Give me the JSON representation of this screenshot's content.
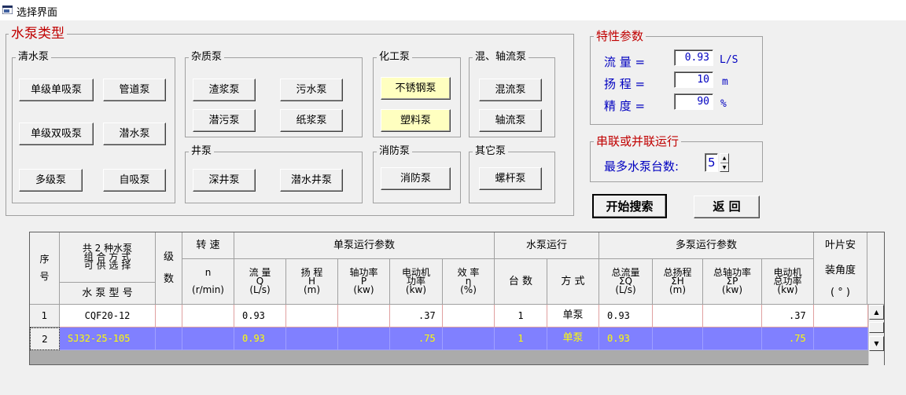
{
  "window": {
    "title": "选择界面",
    "icon": "app-icon"
  },
  "pump_types": {
    "legend": "水泵类型",
    "clear_water": {
      "legend": "清水泵",
      "buttons": [
        "单级单吸泵",
        "管道泵",
        "单级双吸泵",
        "潜水泵",
        "多级泵",
        "自吸泵"
      ]
    },
    "impurity": {
      "legend": "杂质泵",
      "buttons": [
        "渣浆泵",
        "污水泵",
        "潜污泵",
        "纸浆泵"
      ]
    },
    "well": {
      "legend": "井泵",
      "buttons": [
        "深井泵",
        "潜水井泵"
      ]
    },
    "chemical": {
      "legend": "化工泵",
      "buttons": [
        "不锈钢泵",
        "塑料泵"
      ]
    },
    "mixed_axial": {
      "legend": "混、轴流泵",
      "buttons": [
        "混流泵",
        "轴流泵"
      ]
    },
    "fire": {
      "legend": "消防泵",
      "buttons": [
        "消防泵"
      ]
    },
    "other": {
      "legend": "其它泵",
      "buttons": [
        "螺杆泵"
      ]
    }
  },
  "params": {
    "legend": "特性参数",
    "flow": {
      "label": "流  量 =",
      "value": "0.93",
      "unit": "L/S"
    },
    "head": {
      "label": "扬  程 =",
      "value": "10",
      "unit": "m"
    },
    "precision": {
      "label": "精  度 =",
      "value": "90",
      "unit": "%"
    }
  },
  "series_parallel": {
    "legend": "串联或并联运行",
    "max_label": "最多水泵台数:",
    "max_value": "5"
  },
  "actions": {
    "search": "开始搜索",
    "back": "返  回"
  },
  "table": {
    "headers": {
      "seq": "序\n\n号",
      "combo": "共 2 种水泵\n组 合 方 式\n可 供 选 择",
      "model": "水 泵 型 号",
      "stage": "级\n\n数",
      "speed_top": "转  速",
      "speed_sub": "n\n\n(r/min)",
      "single": "单泵运行参数",
      "flow": "流  量\nQ\n(L/s)",
      "head": "扬  程\nH\n(m)",
      "shaft": "轴功率\nP\n(kw)",
      "motor": "电动机\n功率\n(kw)",
      "eff": "效  率\nη\n(%)",
      "run": "水泵运行",
      "count": "台  数",
      "mode": "方  式",
      "multi": "多泵运行参数",
      "tflow": "总流量\nΣQ\n(L/s)",
      "thead": "总扬程\nΣH\n(m)",
      "tshaft": "总轴功率\nΣP\n(kw)",
      "tmotor": "电动机\n总功率\n(kw)",
      "blade1": "叶片安",
      "blade2": "装角度\n\n( ° )"
    },
    "rows": [
      {
        "num": "1",
        "model": "CQF20-12",
        "stage": "",
        "speed": "",
        "flow": "0.93",
        "head": "",
        "shaft": "",
        "motor": ".37",
        "eff": "",
        "count": "1",
        "mode": "单泵",
        "tflow": "0.93",
        "thead": "",
        "tshaft": "",
        "tmotor": ".37",
        "blade": ""
      },
      {
        "num": "2",
        "model": "SJ32-25-105",
        "stage": "",
        "speed": "",
        "flow": "0.93",
        "head": "",
        "shaft": "",
        "motor": ".75",
        "eff": "",
        "count": "1",
        "mode": "单泵",
        "tflow": "0.93",
        "thead": "",
        "tshaft": "",
        "tmotor": ".75",
        "blade": ""
      }
    ]
  },
  "colors": {
    "legend_red": "#c00000",
    "label_blue": "#0000c0",
    "selected_row": "#8080ff",
    "selected_text": "#ffff00",
    "button_yellow": "#ffffc0"
  }
}
